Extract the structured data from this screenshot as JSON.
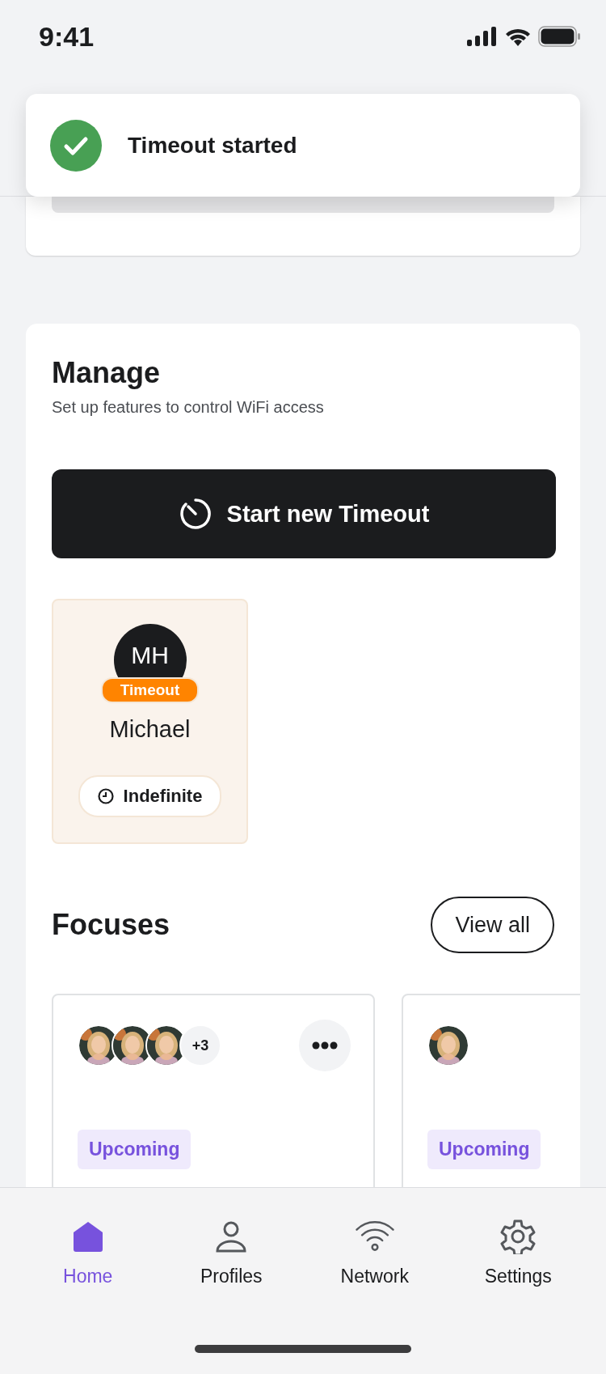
{
  "status_bar": {
    "time": "9:41"
  },
  "toast": {
    "message": "Timeout started"
  },
  "manage": {
    "title": "Manage",
    "subtitle": "Set up features to control WiFi access",
    "button": "Start new Timeout",
    "profiles": [
      {
        "initials": "MH",
        "badge": "Timeout",
        "name": "Michael",
        "duration": "Indefinite"
      }
    ]
  },
  "focuses": {
    "title": "Focuses",
    "view_all": "View all",
    "cards": [
      {
        "more_count": "+3",
        "more_button": true,
        "status": "Upcoming"
      },
      {
        "status": "Upcoming"
      }
    ]
  },
  "tab_bar": [
    {
      "kind": "home",
      "label": "Home",
      "selected": true
    },
    {
      "kind": "profiles",
      "label": "Profiles",
      "selected": false
    },
    {
      "kind": "network",
      "label": "Network",
      "selected": false
    },
    {
      "kind": "settings",
      "label": "Settings",
      "selected": false
    }
  ]
}
